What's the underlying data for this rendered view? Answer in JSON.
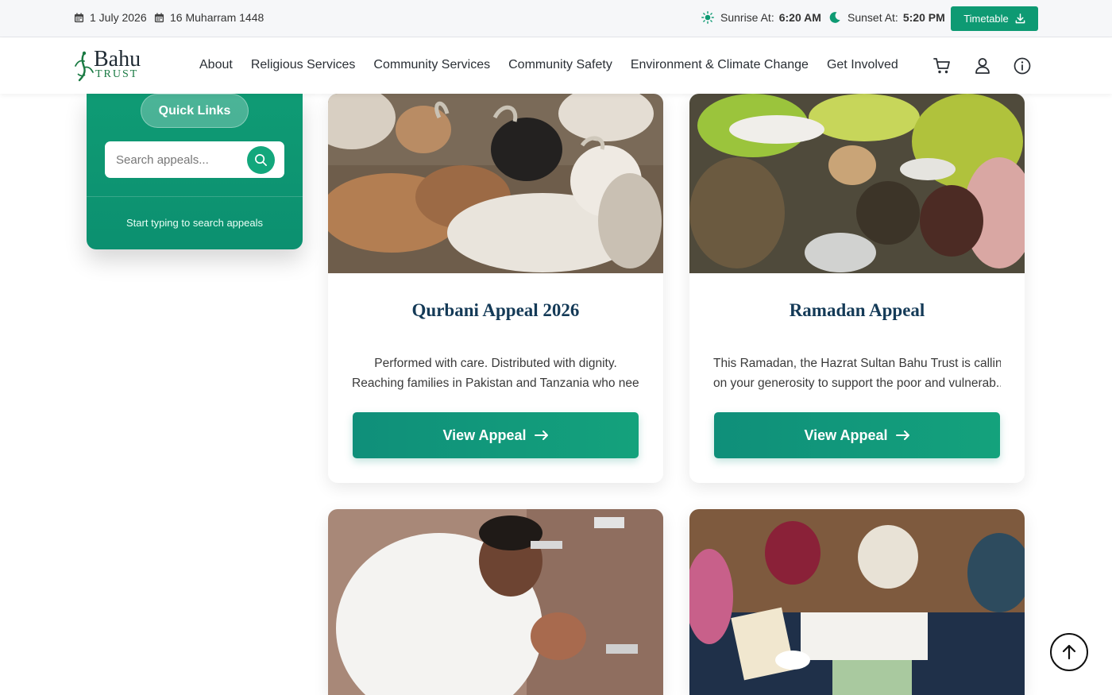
{
  "topbar": {
    "gregorian_date": "1 July 2026",
    "hijri_date": "16 Muharram 1448",
    "sunrise_label": "Sunrise At:",
    "sunrise_time": "6:20 AM",
    "sunset_label": "Sunset At:",
    "sunset_time": "5:20 PM",
    "timetable_label": "Timetable"
  },
  "logo": {
    "line1": "Bahu",
    "line2": "TRUST"
  },
  "nav": {
    "items": [
      "About",
      "Religious Services",
      "Community Services",
      "Community Safety",
      "Environment & Climate Change",
      "Get Involved"
    ]
  },
  "header_icons": [
    "cart-icon",
    "user-icon",
    "info-icon"
  ],
  "quick_links": {
    "title": "Quick Links",
    "search_placeholder": "Search appeals...",
    "hint": "Start typing to search appeals"
  },
  "appeals": [
    {
      "title": "Qurbani Appeal 2026",
      "desc_line1": "Performed with care. Distributed with dignity.",
      "desc_line2": "Reaching families in Pakistan and Tanzania who nee...",
      "button": "View Appeal",
      "image": "goats photo"
    },
    {
      "title": "Ramadan Appeal",
      "desc_line1": "This Ramadan, the Hazrat Sultan Bahu Trust is calling",
      "desc_line2": "on your generosity to support the poor and vulnerab...",
      "button": "View Appeal",
      "image": "food distribution photo"
    }
  ],
  "colors": {
    "accent": "#0e9a73",
    "title": "#143a57"
  }
}
